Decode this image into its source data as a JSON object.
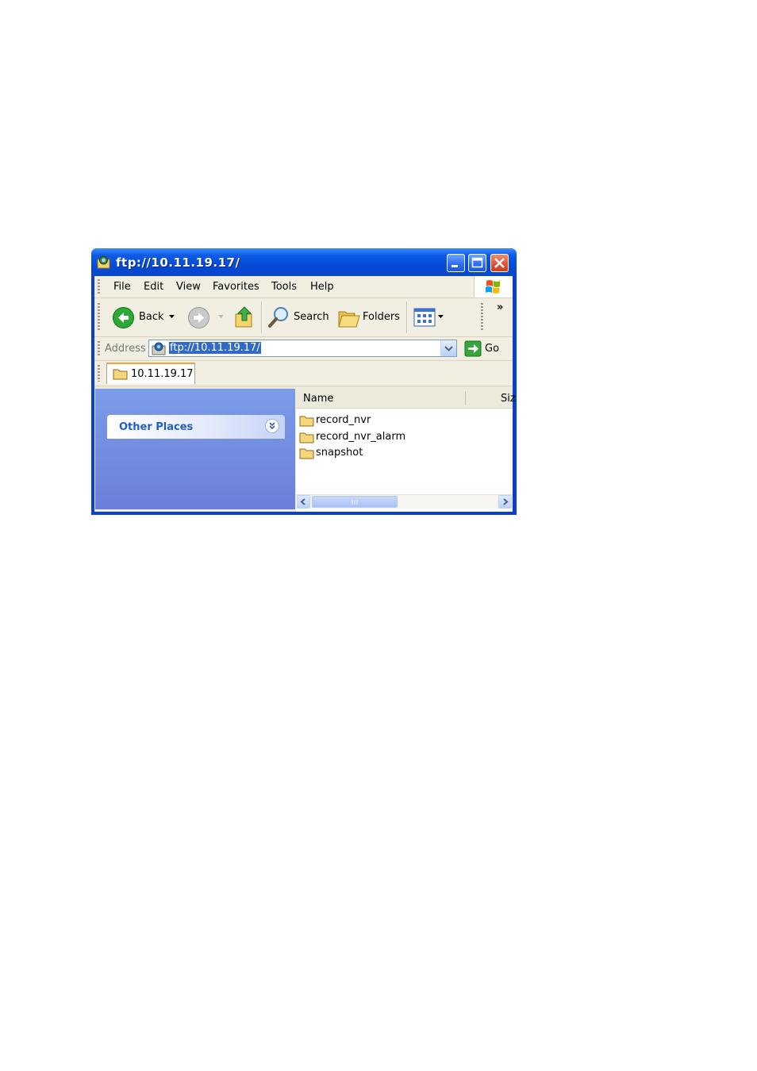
{
  "window": {
    "title": "ftp://10.11.19.17/"
  },
  "menubar": {
    "items": [
      "File",
      "Edit",
      "View",
      "Favorites",
      "Tools",
      "Help"
    ]
  },
  "toolbar": {
    "back_label": "Back",
    "search_label": "Search",
    "folders_label": "Folders",
    "chevron_label": "»"
  },
  "address": {
    "label": "Address",
    "value": "ftp://10.11.19.17/",
    "go_label": "Go"
  },
  "tab": {
    "label": "10.11.19.17"
  },
  "sidebar": {
    "panel_title": "Other Places"
  },
  "list": {
    "columns": [
      "Name",
      "Siz"
    ],
    "files": [
      "record_nvr",
      "record_nvr_alarm",
      "snapshot"
    ]
  },
  "colors": {
    "titlebar": "#0a47c9",
    "sidebar": "#6b7fd8",
    "selection": "#316ac5"
  }
}
